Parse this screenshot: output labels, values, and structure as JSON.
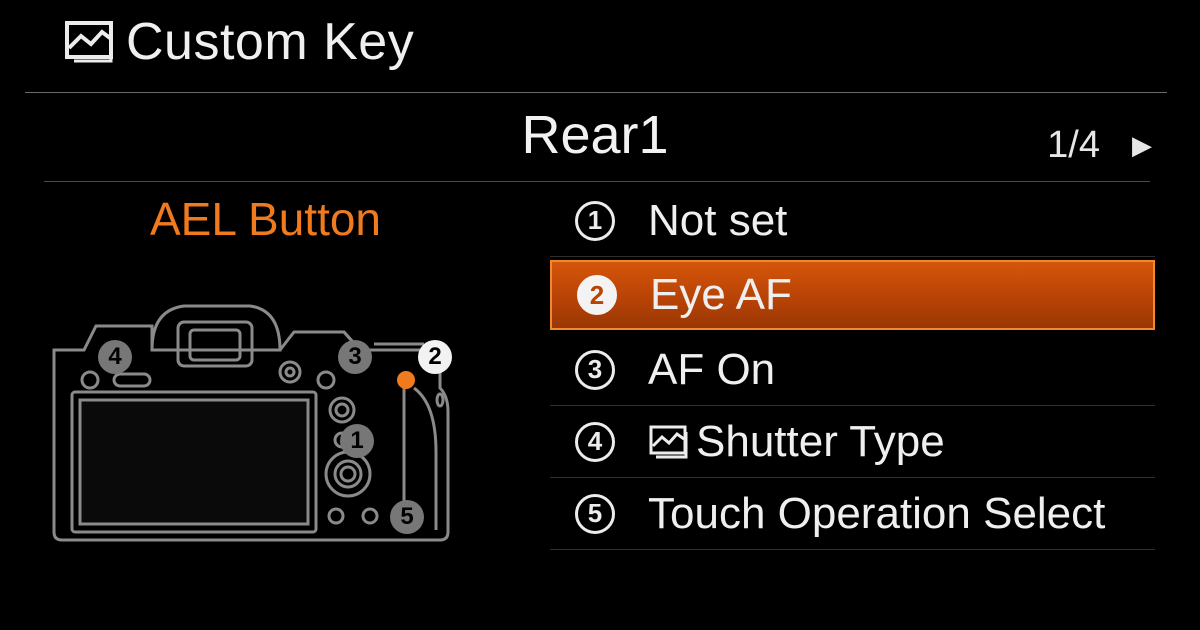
{
  "header": {
    "title": "Custom Key",
    "icon": "photo-mode-icon"
  },
  "tab": {
    "title": "Rear1",
    "page": "1/4",
    "next_icon": "triangle-right-icon"
  },
  "selected_button": {
    "label": "AEL Button",
    "color": "#f07a1e"
  },
  "camera_callouts": [
    "1",
    "2",
    "3",
    "4",
    "5"
  ],
  "options": [
    {
      "number": "1",
      "label": "Not set",
      "selected": false,
      "icon": null
    },
    {
      "number": "2",
      "label": "Eye AF",
      "selected": true,
      "icon": null
    },
    {
      "number": "3",
      "label": "AF On",
      "selected": false,
      "icon": null
    },
    {
      "number": "4",
      "label": "Shutter Type",
      "selected": false,
      "icon": "photo-mode-icon"
    },
    {
      "number": "5",
      "label": "Touch Operation Select",
      "selected": false,
      "icon": null
    }
  ],
  "colors": {
    "accent": "#f07a1e",
    "highlight": "#c64b07",
    "background": "#000000",
    "text": "#ececec"
  }
}
